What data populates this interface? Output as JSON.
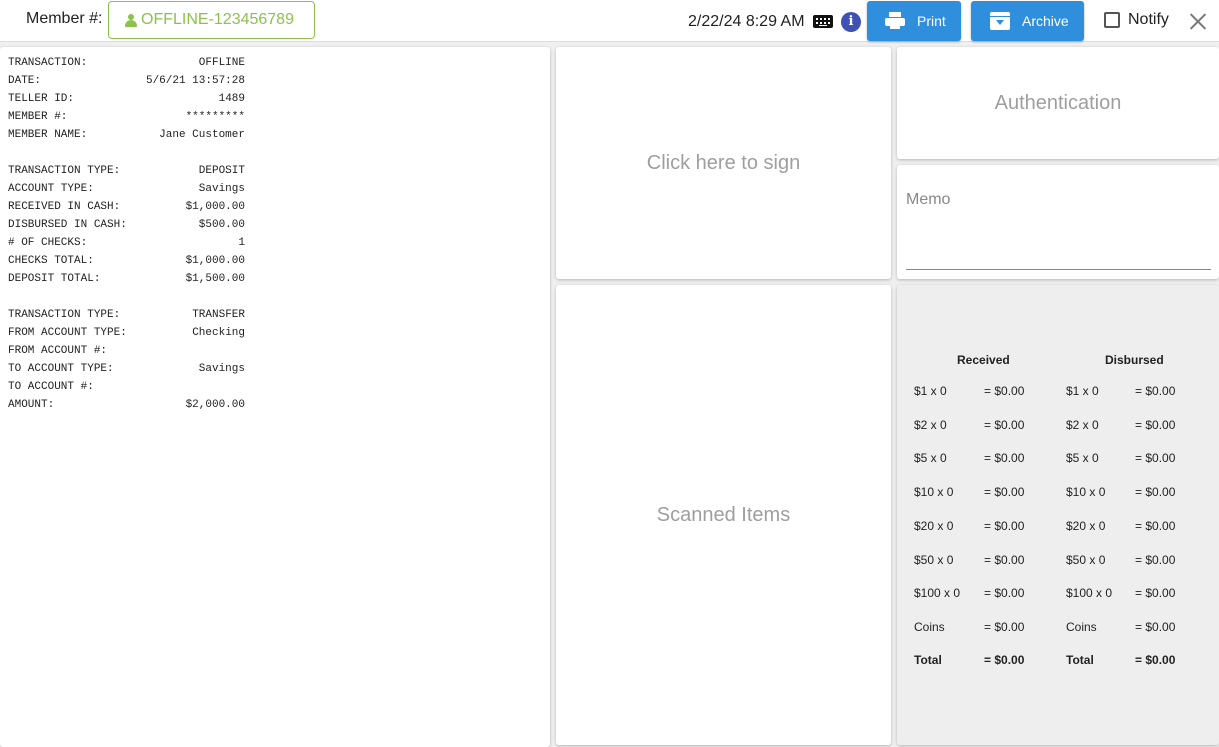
{
  "header": {
    "member_label": "Member #:",
    "member_number": "OFFLINE-123456789",
    "datetime": "2/22/24 8:29 AM",
    "print_label": "Print",
    "archive_label": "Archive",
    "notify_label": "Notify",
    "accent_color": "#2f8fdd",
    "member_color": "#8bc34a"
  },
  "receipt": {
    "group1": [
      {
        "label": "TRANSACTION:",
        "value": "OFFLINE"
      },
      {
        "label": "DATE:",
        "value": "5/6/21 13:57:28"
      },
      {
        "label": "TELLER ID:",
        "value": "1489"
      },
      {
        "label": "MEMBER #:",
        "value": "*********"
      },
      {
        "label": "MEMBER NAME:",
        "value": "Jane Customer"
      }
    ],
    "group2": [
      {
        "label": "TRANSACTION TYPE:",
        "value": "DEPOSIT"
      },
      {
        "label": "ACCOUNT TYPE:",
        "value": "Savings"
      },
      {
        "label": "RECEIVED IN CASH:",
        "value": "$1,000.00"
      },
      {
        "label": "DISBURSED IN CASH:",
        "value": "$500.00"
      },
      {
        "label": "# OF CHECKS:",
        "value": "1"
      },
      {
        "label": "CHECKS TOTAL:",
        "value": "$1,000.00"
      },
      {
        "label": "DEPOSIT TOTAL:",
        "value": "$1,500.00"
      }
    ],
    "group3": [
      {
        "label": "TRANSACTION TYPE:",
        "value": "TRANSFER"
      },
      {
        "label": "FROM ACCOUNT TYPE:",
        "value": "Checking"
      },
      {
        "label": "FROM ACCOUNT #:",
        "value": ""
      },
      {
        "label": "TO ACCOUNT TYPE:",
        "value": "Savings"
      },
      {
        "label": "TO ACCOUNT #:",
        "value": ""
      },
      {
        "label": "AMOUNT:",
        "value": "$2,000.00"
      }
    ]
  },
  "signature": {
    "prompt": "Click here to sign"
  },
  "scanned": {
    "label": "Scanned Items"
  },
  "auth": {
    "label": "Authentication"
  },
  "memo": {
    "label": "Memo",
    "value": ""
  },
  "cash": {
    "received_header": "Received",
    "disbursed_header": "Disbursed",
    "rows": [
      {
        "r_label": "$1 x 0",
        "r_value": "= $0.00",
        "d_label": "$1 x 0",
        "d_value": "= $0.00"
      },
      {
        "r_label": "$2 x 0",
        "r_value": "= $0.00",
        "d_label": "$2 x 0",
        "d_value": "= $0.00"
      },
      {
        "r_label": "$5 x 0",
        "r_value": "= $0.00",
        "d_label": "$5 x 0",
        "d_value": "= $0.00"
      },
      {
        "r_label": "$10 x 0",
        "r_value": "= $0.00",
        "d_label": "$10 x 0",
        "d_value": "= $0.00"
      },
      {
        "r_label": "$20 x 0",
        "r_value": "= $0.00",
        "d_label": "$20 x 0",
        "d_value": "= $0.00"
      },
      {
        "r_label": "$50 x 0",
        "r_value": "= $0.00",
        "d_label": "$50 x 0",
        "d_value": "= $0.00"
      },
      {
        "r_label": "$100 x 0",
        "r_value": "= $0.00",
        "d_label": "$100 x 0",
        "d_value": "= $0.00"
      },
      {
        "r_label": "Coins",
        "r_value": "= $0.00",
        "d_label": "Coins",
        "d_value": "= $0.00"
      }
    ],
    "total": {
      "r_label": "Total",
      "r_value": "= $0.00",
      "d_label": "Total",
      "d_value": "= $0.00"
    }
  }
}
